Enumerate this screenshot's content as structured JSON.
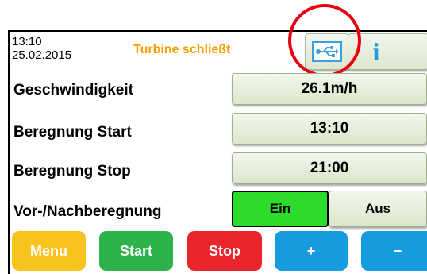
{
  "header": {
    "time": "13:10",
    "date": "25.02.2015",
    "status": "Turbine schließt",
    "usb_icon": "usb-icon",
    "info_icon": "info-icon",
    "info_label": "i"
  },
  "rows": [
    {
      "label": "Geschwindigkeit",
      "value": "26.1m/h"
    },
    {
      "label": "Beregnung Start",
      "value": "13:10"
    },
    {
      "label": "Beregnung Stop",
      "value": "21:00"
    },
    {
      "label": "Vor-/Nachberegnung"
    }
  ],
  "toggle": {
    "on_label": "Ein",
    "off_label": "Aus",
    "selected": "Ein"
  },
  "softkeys": {
    "menu": "Menu",
    "start": "Start",
    "stop": "Stop",
    "plus": "+",
    "minus": "−"
  },
  "colors": {
    "status": "#f5a000",
    "highlight_circle": "#e8000e",
    "toggle_on": "#2ddc2a",
    "menu": "#f8c21d",
    "start": "#2bb24a",
    "stop": "#e9242a",
    "plus_minus": "#169bde",
    "usb": "#3aa0df"
  }
}
